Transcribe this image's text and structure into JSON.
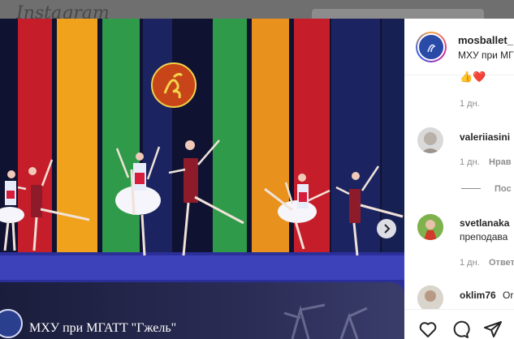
{
  "background_page": {
    "logo_text": "Instagram"
  },
  "post": {
    "overlay_title": "МХУ при МГАТТ \"Гжель\""
  },
  "header": {
    "username": "mosballet_",
    "subtitle": "МХУ при МГ"
  },
  "caption": {
    "emojis": "👍❤️",
    "time": "1 дн."
  },
  "comments": [
    {
      "username": "valeriiasini",
      "text": "",
      "time": "1 дн.",
      "action": "Нрав"
    },
    {
      "username": "svetlanaka",
      "text": "преподава",
      "time": "1 дн.",
      "action": "Ответ"
    },
    {
      "username": "oklim76",
      "text": "Or"
    }
  ],
  "replies": {
    "label": "Пос"
  },
  "icons": [
    "heart-icon",
    "comment-icon",
    "share-icon",
    "next-arrow-icon"
  ],
  "colors": {
    "panel_bg": "#ffffff",
    "text_primary": "#262626",
    "text_secondary": "#8e8e8e",
    "stage_floor": "#3b3fb8"
  }
}
